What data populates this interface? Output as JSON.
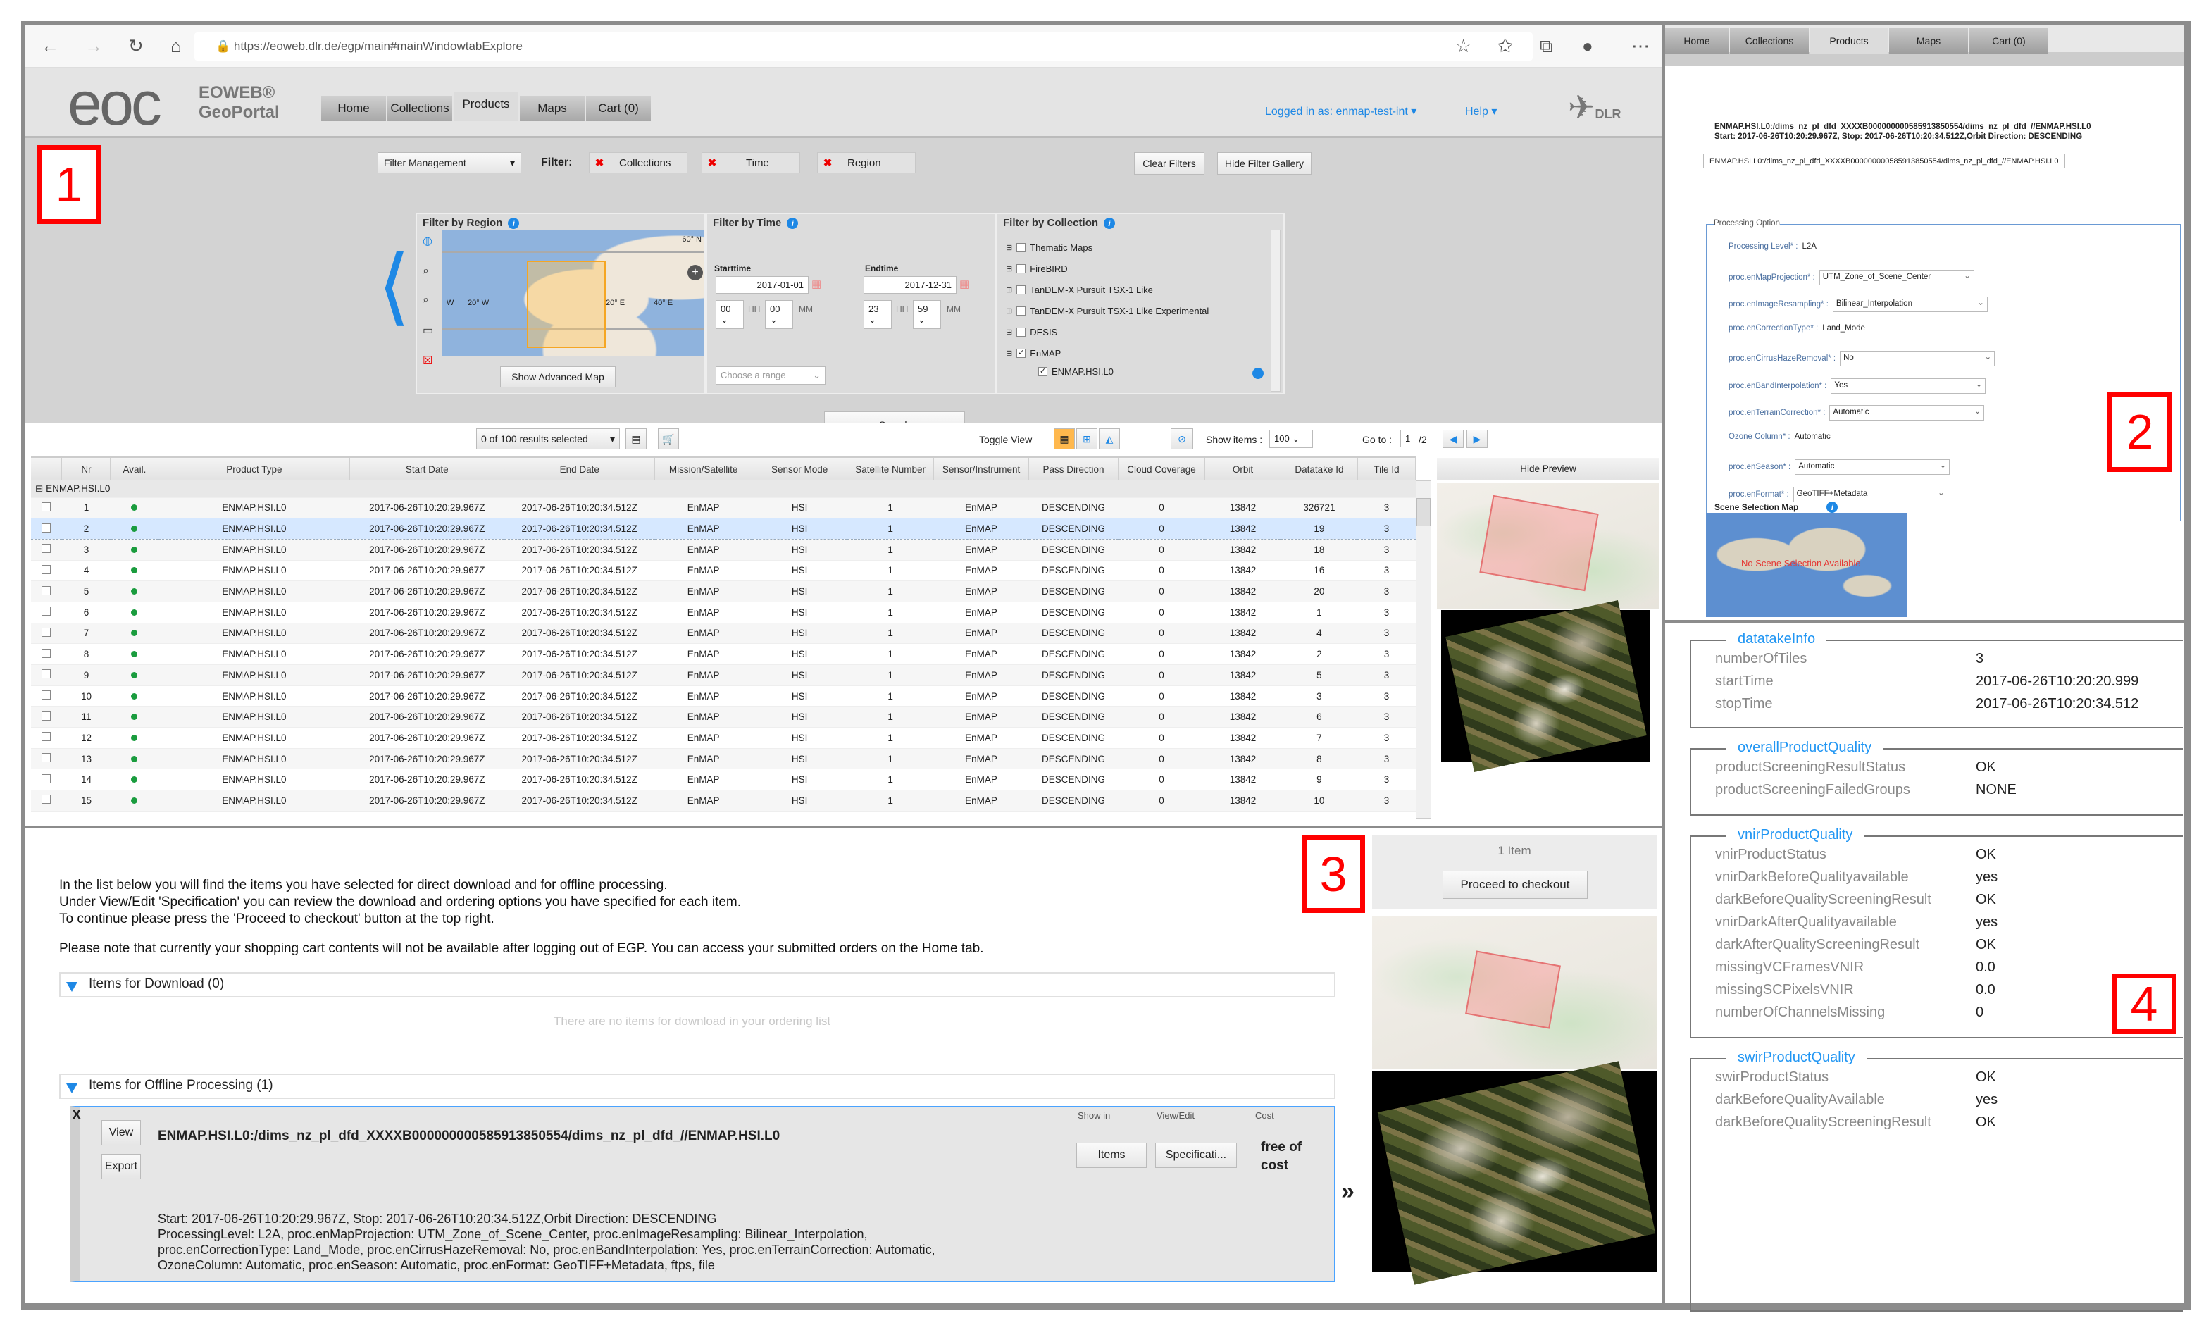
{
  "browser": {
    "url": "https://eoweb.dlr.de/egp/main#mainWindowtabExplore"
  },
  "header": {
    "logo": "eoc",
    "brand_line1": "EOWEB®",
    "brand_line2": "GeoPortal",
    "logged_in": "Logged in as: enmap-test-int ▾",
    "help": "Help ▾",
    "dlr": "DLR",
    "tabs": [
      "Home",
      "Collections",
      "Products",
      "Maps",
      "Cart (0)"
    ],
    "active_tab": "Products"
  },
  "filters": {
    "filter_management": "Filter Management",
    "filter_label": "Filter:",
    "chips": [
      "Collections",
      "Time",
      "Region"
    ],
    "clear_filters": "Clear Filters",
    "hide_filter_gallery": "Hide Filter Gallery",
    "region": {
      "title": "Filter by Region",
      "map_labels": [
        "60° N",
        "W",
        "20° W",
        "20° E",
        "40° E"
      ],
      "show_advanced_map": "Show Advanced Map"
    },
    "time": {
      "title": "Filter by Time",
      "starttime_label": "Starttime",
      "endtime_label": "Endtime",
      "start_date": "2017-01-01",
      "end_date": "2017-12-31",
      "start_hh": "00",
      "start_mm": "00",
      "end_hh": "23",
      "end_mm": "59",
      "hh": "HH",
      "mm": "MM",
      "range_placeholder": "Choose a range"
    },
    "collection": {
      "title": "Filter by Collection",
      "items": [
        {
          "label": "Thematic Maps",
          "checked": false
        },
        {
          "label": "FireBIRD",
          "checked": false
        },
        {
          "label": "TanDEM-X Pursuit TSX-1 Like",
          "checked": false
        },
        {
          "label": "TanDEM-X Pursuit TSX-1 Like Experimental",
          "checked": false
        },
        {
          "label": "DESIS",
          "checked": false
        },
        {
          "label": "EnMAP",
          "checked": true
        }
      ],
      "sub_item": "ENMAP.HSI.L0"
    },
    "search": "Search"
  },
  "results": {
    "selected": "0 of 100 results selected",
    "toggle_view": "Toggle View",
    "show_items_label": "Show items :",
    "show_items": "100",
    "goto_label": "Go to :",
    "page": "1",
    "pages": "/2",
    "hide_preview": "Hide Preview",
    "columns": [
      "",
      "Nr",
      "Avail.",
      "Product Type",
      "Start Date",
      "End Date",
      "Mission/Satellite",
      "Sensor Mode",
      "Satellite Number",
      "Sensor/Instrument",
      "Pass Direction",
      "Cloud Coverage",
      "Orbit",
      "Datatake Id",
      "Tile Id"
    ],
    "group": "ENMAP.HSI.L0",
    "rows": [
      {
        "nr": "1",
        "type": "ENMAP.HSI.L0",
        "start": "2017-06-26T10:20:29.967Z",
        "end": "2017-06-26T10:20:34.512Z",
        "mission": "EnMAP",
        "mode": "HSI",
        "satnum": "1",
        "instrument": "EnMAP",
        "pass": "DESCENDING",
        "cloud": "0",
        "orbit": "13842",
        "datatake": "326721",
        "tile": "3"
      },
      {
        "nr": "2",
        "type": "ENMAP.HSI.L0",
        "start": "2017-06-26T10:20:29.967Z",
        "end": "2017-06-26T10:20:34.512Z",
        "mission": "EnMAP",
        "mode": "HSI",
        "satnum": "1",
        "instrument": "EnMAP",
        "pass": "DESCENDING",
        "cloud": "0",
        "orbit": "13842",
        "datatake": "19",
        "tile": "3",
        "selected": true
      },
      {
        "nr": "3",
        "type": "ENMAP.HSI.L0",
        "start": "2017-06-26T10:20:29.967Z",
        "end": "2017-06-26T10:20:34.512Z",
        "mission": "EnMAP",
        "mode": "HSI",
        "satnum": "1",
        "instrument": "EnMAP",
        "pass": "DESCENDING",
        "cloud": "0",
        "orbit": "13842",
        "datatake": "18",
        "tile": "3"
      },
      {
        "nr": "4",
        "type": "ENMAP.HSI.L0",
        "start": "2017-06-26T10:20:29.967Z",
        "end": "2017-06-26T10:20:34.512Z",
        "mission": "EnMAP",
        "mode": "HSI",
        "satnum": "1",
        "instrument": "EnMAP",
        "pass": "DESCENDING",
        "cloud": "0",
        "orbit": "13842",
        "datatake": "16",
        "tile": "3"
      },
      {
        "nr": "5",
        "type": "ENMAP.HSI.L0",
        "start": "2017-06-26T10:20:29.967Z",
        "end": "2017-06-26T10:20:34.512Z",
        "mission": "EnMAP",
        "mode": "HSI",
        "satnum": "1",
        "instrument": "EnMAP",
        "pass": "DESCENDING",
        "cloud": "0",
        "orbit": "13842",
        "datatake": "20",
        "tile": "3"
      },
      {
        "nr": "6",
        "type": "ENMAP.HSI.L0",
        "start": "2017-06-26T10:20:29.967Z",
        "end": "2017-06-26T10:20:34.512Z",
        "mission": "EnMAP",
        "mode": "HSI",
        "satnum": "1",
        "instrument": "EnMAP",
        "pass": "DESCENDING",
        "cloud": "0",
        "orbit": "13842",
        "datatake": "1",
        "tile": "3"
      },
      {
        "nr": "7",
        "type": "ENMAP.HSI.L0",
        "start": "2017-06-26T10:20:29.967Z",
        "end": "2017-06-26T10:20:34.512Z",
        "mission": "EnMAP",
        "mode": "HSI",
        "satnum": "1",
        "instrument": "EnMAP",
        "pass": "DESCENDING",
        "cloud": "0",
        "orbit": "13842",
        "datatake": "4",
        "tile": "3"
      },
      {
        "nr": "8",
        "type": "ENMAP.HSI.L0",
        "start": "2017-06-26T10:20:29.967Z",
        "end": "2017-06-26T10:20:34.512Z",
        "mission": "EnMAP",
        "mode": "HSI",
        "satnum": "1",
        "instrument": "EnMAP",
        "pass": "DESCENDING",
        "cloud": "0",
        "orbit": "13842",
        "datatake": "2",
        "tile": "3"
      },
      {
        "nr": "9",
        "type": "ENMAP.HSI.L0",
        "start": "2017-06-26T10:20:29.967Z",
        "end": "2017-06-26T10:20:34.512Z",
        "mission": "EnMAP",
        "mode": "HSI",
        "satnum": "1",
        "instrument": "EnMAP",
        "pass": "DESCENDING",
        "cloud": "0",
        "orbit": "13842",
        "datatake": "5",
        "tile": "3"
      },
      {
        "nr": "10",
        "type": "ENMAP.HSI.L0",
        "start": "2017-06-26T10:20:29.967Z",
        "end": "2017-06-26T10:20:34.512Z",
        "mission": "EnMAP",
        "mode": "HSI",
        "satnum": "1",
        "instrument": "EnMAP",
        "pass": "DESCENDING",
        "cloud": "0",
        "orbit": "13842",
        "datatake": "3",
        "tile": "3"
      },
      {
        "nr": "11",
        "type": "ENMAP.HSI.L0",
        "start": "2017-06-26T10:20:29.967Z",
        "end": "2017-06-26T10:20:34.512Z",
        "mission": "EnMAP",
        "mode": "HSI",
        "satnum": "1",
        "instrument": "EnMAP",
        "pass": "DESCENDING",
        "cloud": "0",
        "orbit": "13842",
        "datatake": "6",
        "tile": "3"
      },
      {
        "nr": "12",
        "type": "ENMAP.HSI.L0",
        "start": "2017-06-26T10:20:29.967Z",
        "end": "2017-06-26T10:20:34.512Z",
        "mission": "EnMAP",
        "mode": "HSI",
        "satnum": "1",
        "instrument": "EnMAP",
        "pass": "DESCENDING",
        "cloud": "0",
        "orbit": "13842",
        "datatake": "7",
        "tile": "3"
      },
      {
        "nr": "13",
        "type": "ENMAP.HSI.L0",
        "start": "2017-06-26T10:20:29.967Z",
        "end": "2017-06-26T10:20:34.512Z",
        "mission": "EnMAP",
        "mode": "HSI",
        "satnum": "1",
        "instrument": "EnMAP",
        "pass": "DESCENDING",
        "cloud": "0",
        "orbit": "13842",
        "datatake": "8",
        "tile": "3"
      },
      {
        "nr": "14",
        "type": "ENMAP.HSI.L0",
        "start": "2017-06-26T10:20:29.967Z",
        "end": "2017-06-26T10:20:34.512Z",
        "mission": "EnMAP",
        "mode": "HSI",
        "satnum": "1",
        "instrument": "EnMAP",
        "pass": "DESCENDING",
        "cloud": "0",
        "orbit": "13842",
        "datatake": "9",
        "tile": "3"
      },
      {
        "nr": "15",
        "type": "ENMAP.HSI.L0",
        "start": "2017-06-26T10:20:29.967Z",
        "end": "2017-06-26T10:20:34.512Z",
        "mission": "EnMAP",
        "mode": "HSI",
        "satnum": "1",
        "instrument": "EnMAP",
        "pass": "DESCENDING",
        "cloud": "0",
        "orbit": "13842",
        "datatake": "10",
        "tile": "3"
      }
    ]
  },
  "annotations": [
    "1",
    "2",
    "3",
    "4"
  ],
  "spec": {
    "tabs": [
      "Home",
      "Collections",
      "Products",
      "Maps",
      "Cart (0)"
    ],
    "title": "ENMAP.HSI.L0:/dims_nz_pl_dfd_XXXXB0000000005859138505​54/dims_nz_pl_dfd_//ENMAP.HSI.L0",
    "subtitle": "Start: 2017-06-26T10:20:29.967Z, Stop: 2017-06-26T10:20:34.512Z,Orbit Direction: DESCENDING",
    "item_tab": "ENMAP.HSI.L0:/dims_nz_pl_dfd_XXXXB0000000005859138505​54/dims_nz_pl_dfd_//ENMAP.HSI.L0",
    "legend": "Processing Option",
    "options": [
      {
        "label": "Processing Level* :",
        "value": "L2A",
        "type": "text"
      },
      {
        "label": "proc.enMapProjection* :",
        "value": "UTM_Zone_of_Scene_Center",
        "type": "select"
      },
      {
        "label": "proc.enImageResampling* :",
        "value": "Bilinear_Interpolation",
        "type": "select"
      },
      {
        "label": "proc.enCorrectionType* :",
        "value": "Land_Mode",
        "type": "text"
      },
      {
        "label": "proc.enCirrusHazeRemoval* :",
        "value": "No",
        "type": "select"
      },
      {
        "label": "proc.enBandInterpolation* :",
        "value": "Yes",
        "type": "select"
      },
      {
        "label": "proc.enTerrainCorrection* :",
        "value": "Automatic",
        "type": "select"
      },
      {
        "label": "Ozone Column* :",
        "value": "Automatic",
        "type": "text"
      },
      {
        "label": "proc.enSeason* :",
        "value": "Automatic",
        "type": "select"
      },
      {
        "label": "proc.enFormat* :",
        "value": "GeoTIFF+Metadata",
        "type": "select"
      }
    ],
    "scene_map_title": "Scene Selection Map",
    "scene_map_msg": "No Scene Selection Available"
  },
  "cart": {
    "intro": [
      "In the list below you will find the items you have selected for direct download and for offline processing.",
      "Under View/Edit 'Specification' you can review the download and ordering options you have specified for each item.",
      "To continue please press the 'Proceed to checkout' button at the top right."
    ],
    "note": "Please note that currently your shopping cart contents will not be available after logging out of EGP. You can access your submitted orders on the Home tab.",
    "download_section": "Items for Download (0)",
    "download_empty": "There are no items for download in your ordering list",
    "offline_section": "Items for Offline Processing (1)",
    "item": {
      "close": "X",
      "view": "View",
      "export": "Export",
      "title": "ENMAP.HSI.L0:/dims_nz_pl_dfd_XXXXB0000000005859138505​54/dims_nz_pl_dfd_//ENMAP.HSI.L0",
      "show_in": "Show in",
      "view_edit": "View/Edit",
      "cost_label": "Cost",
      "items_btn": "Items",
      "spec_btn": "Specificati...",
      "cost": "free of cost",
      "details": [
        "Start: 2017-06-26T10:20:29.967Z, Stop: 2017-06-26T10:20:34.512Z,Orbit Direction: DESCENDING",
        "ProcessingLevel: L2A, proc.enMapProjection: UTM_Zone_of_Scene_Center, proc.enImageResampling: Bilinear_Interpolation,",
        "proc.enCorrectionType: Land_Mode, proc.enCirrusHazeRemoval: No, proc.enBandInterpolation: Yes, proc.enTerrainCorrection: Automatic,",
        "OzoneColumn: Automatic, proc.enSeason: Automatic, proc.enFormat: GeoTIFF+Metadata, ftps, file"
      ]
    },
    "expand": "»",
    "item_count": "1 Item",
    "checkout": "Proceed to checkout"
  },
  "metadata": [
    {
      "legend": "datatakeInfo",
      "rows": [
        [
          "numberOfTiles",
          "3"
        ],
        [
          "startTime",
          "2017-06-26T10:20:20.999"
        ],
        [
          "stopTime",
          "2017-06-26T10:20:34.512"
        ]
      ]
    },
    {
      "legend": "overallProductQuality",
      "rows": [
        [
          "productScreeningResultStatus",
          "OK"
        ],
        [
          "productScreeningFailedGroups",
          "NONE"
        ]
      ]
    },
    {
      "legend": "vnirProductQuality",
      "rows": [
        [
          "vnirProductStatus",
          "OK"
        ],
        [
          "vnirDarkBeforeQualityavailable",
          "yes"
        ],
        [
          "darkBeforeQualityScreeningResult",
          "OK"
        ],
        [
          "vnirDarkAfterQualityavailable",
          "yes"
        ],
        [
          "darkAfterQualityScreeningResult",
          "OK"
        ],
        [
          "missingVCFramesVNIR",
          "0.0"
        ],
        [
          "missingSCPixelsVNIR",
          "0.0"
        ],
        [
          "numberOfChannelsMissing",
          "0"
        ]
      ]
    },
    {
      "legend": "swirProductQuality",
      "rows": [
        [
          "swirProductStatus",
          "OK"
        ],
        [
          "darkBeforeQualityAvailable",
          "yes"
        ],
        [
          "darkBeforeQualityScreeningResult",
          "OK"
        ]
      ]
    }
  ]
}
